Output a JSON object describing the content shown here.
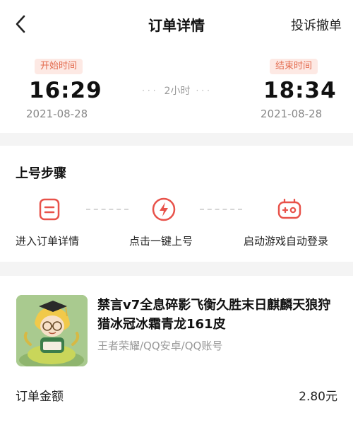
{
  "nav": {
    "back_icon": "chevron-left-icon",
    "title": "订单详情",
    "complaint_label": "投诉撤单"
  },
  "timing": {
    "start_label": "开始时间",
    "start_time": "16:29",
    "start_date": "2021-08-28",
    "duration": "2小时",
    "end_label": "结束时间",
    "end_time": "18:34",
    "end_date": "2021-08-28",
    "accent_color": "#e36b4e"
  },
  "steps": {
    "title": "上号步骤",
    "items": [
      {
        "label": "进入订单详情",
        "icon": "order-detail-icon"
      },
      {
        "label": "点击一键上号",
        "icon": "lightning-icon"
      },
      {
        "label": "启动游戏自动登录",
        "icon": "gamepad-icon"
      }
    ],
    "icon_color": "#e8524a"
  },
  "product": {
    "title": "禁言v7全息碎影飞衡久胜末日麒麟天狼狩猎冰冠冰霜青龙161皮",
    "subtitle": "王者荣耀/QQ安卓/QQ账号",
    "thumbnail_icon": "anime-character-avatar"
  },
  "order": {
    "amount_label": "订单金额",
    "amount_value": "2.80元"
  }
}
